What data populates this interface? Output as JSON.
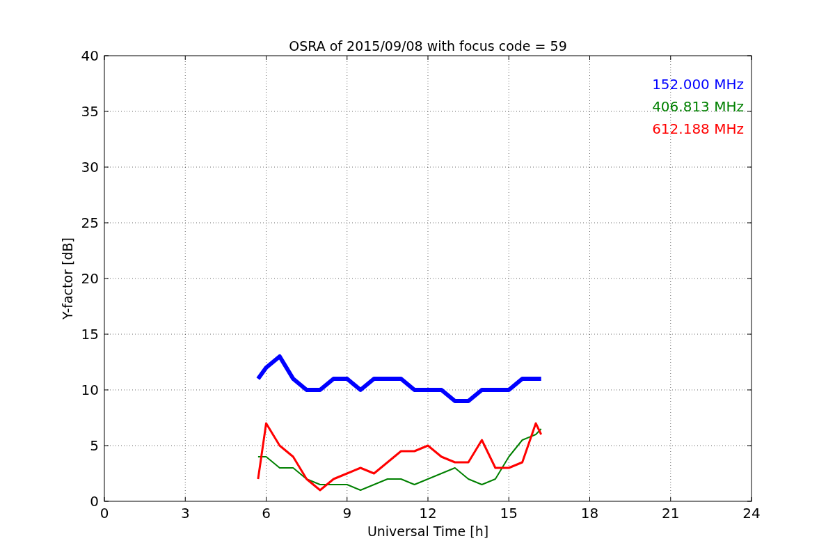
{
  "figure": {
    "chart_data": {
      "type": "line",
      "title": "OSRA of 2015/09/08 with focus code = 59",
      "xlabel": "Universal Time [h]",
      "ylabel": "Y-factor [dB]",
      "x": [
        5.7,
        6,
        6.5,
        7,
        7.5,
        8,
        8.5,
        9,
        9.5,
        10,
        10.5,
        11,
        11.5,
        12,
        12.5,
        13,
        13.5,
        14,
        14.5,
        15,
        15.5,
        16,
        16.2
      ],
      "series": [
        {
          "name": "152.000 MHz",
          "color": "#0000ff",
          "values": [
            11,
            12,
            13,
            11,
            10,
            10,
            11,
            11,
            10,
            11,
            11,
            11,
            10,
            10,
            10,
            9,
            9,
            10,
            10,
            10,
            11,
            11,
            11
          ]
        },
        {
          "name": "406.813 MHz",
          "color": "#008000",
          "values": [
            4,
            4,
            3,
            3,
            2,
            1.5,
            1.5,
            1.5,
            1,
            1.5,
            2,
            2,
            1.5,
            2,
            2.5,
            3,
            2,
            1.5,
            2,
            4,
            5.5,
            6,
            6.5
          ]
        },
        {
          "name": "612.188 MHz",
          "color": "#ff0000",
          "values": [
            2,
            7,
            5,
            4,
            2,
            1,
            2,
            2.5,
            3,
            2.5,
            3.5,
            4.5,
            4.5,
            5,
            4,
            3.5,
            3.5,
            5.5,
            3,
            3,
            3.5,
            7,
            6
          ]
        }
      ],
      "grid": true,
      "xlim": [
        0,
        24
      ],
      "ylim": [
        0,
        40
      ],
      "xticks": [
        0,
        3,
        6,
        9,
        12,
        15,
        18,
        21,
        24
      ],
      "yticks": [
        0,
        5,
        10,
        15,
        20,
        25,
        30,
        35,
        40
      ]
    }
  }
}
